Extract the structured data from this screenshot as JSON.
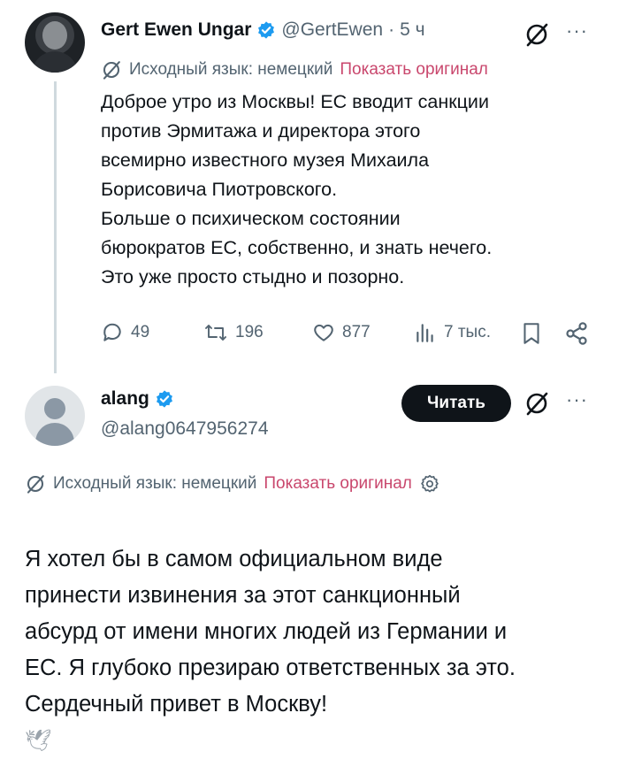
{
  "tweet1": {
    "author_name": "Gert Ewen Ungar",
    "handle": "@GertEwen",
    "separator": "·",
    "time": "5 ч",
    "translation_label": "Исходный язык: немецкий",
    "show_original": "Показать оригинал",
    "text": "Доброе утро из Москвы! ЕС вводит санкции\nпротив Эрмитажа и директора этого\nвсемирно известного музея Михаила\nБорисовича Пиотровского.\nБольше о психическом состоянии\nбюрократов ЕС, собственно, и знать нечего.\nЭто уже просто стыдно и позорно.",
    "actions": {
      "replies": "49",
      "reposts": "196",
      "likes": "877",
      "views": "7 тыс."
    },
    "more": "···"
  },
  "tweet2": {
    "author_name": "alang",
    "handle": "@alang0647956274",
    "follow_label": "Читать",
    "more": "···",
    "translation_label": "Исходный язык: немецкий",
    "show_original": "Показать оригинал",
    "text": "Я хотел бы в самом официальном виде\nпринести извинения за этот санкционный\nабсурд от имени многих людей из Германии и\nЕС. Я глубоко презираю ответственных за это.\nСердечный привет в Москву!",
    "emoji": "🕊"
  },
  "colors": {
    "text": "#0f1419",
    "secondary": "#536471",
    "verified": "#1d9bf0",
    "link": "#c9476d",
    "follow_bg": "#0f1419"
  },
  "icons": [
    "verified-badge-icon",
    "grok-translate-icon",
    "more-icon",
    "reply-icon",
    "repost-icon",
    "like-icon",
    "views-icon",
    "bookmark-icon",
    "share-icon",
    "gear-icon",
    "dove-emoji"
  ]
}
